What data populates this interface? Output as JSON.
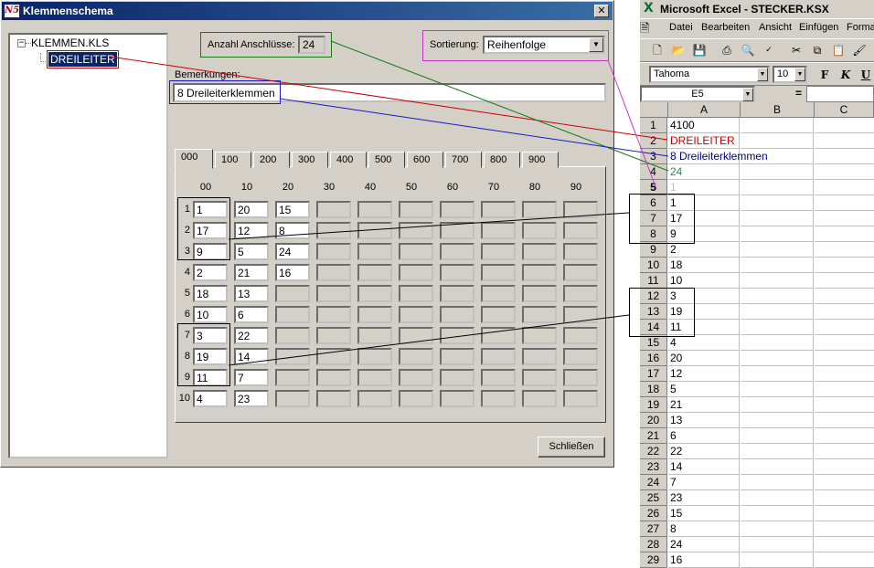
{
  "dialog": {
    "title": "Klemmenschema",
    "app_icon": "app-logo-icon",
    "close_icon": "close-icon",
    "tree": {
      "expander": "⊟",
      "root": "KLEMMEN.KLS",
      "child": "DREILEITER"
    },
    "anzahl_label": "Anzahl Anschlüsse:",
    "anzahl_value": "24",
    "sort_label": "Sortierung:",
    "sort_value": "Reihenfolge",
    "bemerkungen_label": "Bemerkungen:",
    "bemerkungen_value": "8 Dreileiterklemmen",
    "tabs": [
      "000",
      "100",
      "200",
      "300",
      "400",
      "500",
      "600",
      "700",
      "800",
      "900"
    ],
    "active_tab": "000",
    "columns": [
      "00",
      "10",
      "20",
      "30",
      "40",
      "50",
      "60",
      "70",
      "80",
      "90"
    ],
    "rows": [
      {
        "label": "1",
        "cells": [
          "1",
          "20",
          "15"
        ]
      },
      {
        "label": "2",
        "cells": [
          "17",
          "12",
          "8"
        ]
      },
      {
        "label": "3",
        "cells": [
          "9",
          "5",
          "24"
        ]
      },
      {
        "label": "4",
        "cells": [
          "2",
          "21",
          "16"
        ]
      },
      {
        "label": "5",
        "cells": [
          "18",
          "13"
        ]
      },
      {
        "label": "6",
        "cells": [
          "10",
          "6"
        ]
      },
      {
        "label": "7",
        "cells": [
          "3",
          "22"
        ]
      },
      {
        "label": "8",
        "cells": [
          "19",
          "14"
        ]
      },
      {
        "label": "9",
        "cells": [
          "11",
          "7"
        ]
      },
      {
        "label": "10",
        "cells": [
          "4",
          "23"
        ]
      }
    ],
    "close_button": "Schließen"
  },
  "excel": {
    "title": "Microsoft Excel - STECKER.KSX",
    "app_icon": "excel-logo-icon",
    "menu": [
      "Datei",
      "Bearbeiten",
      "Ansicht",
      "Einfügen",
      "Forma"
    ],
    "font_name": "Tahoma",
    "font_size": "10",
    "format_buttons": [
      "F",
      "K",
      "U"
    ],
    "name_box": "E5",
    "formula_sign": "=",
    "col_headers": [
      "A",
      "B",
      "C"
    ],
    "rows": [
      {
        "n": "1",
        "a": "4100",
        "color": "#000000"
      },
      {
        "n": "2",
        "a": "DREILEITER",
        "color": "#cc0000"
      },
      {
        "n": "3",
        "a": "8 Dreileiterklemmen",
        "color": "#000080"
      },
      {
        "n": "4",
        "a": "24",
        "color": "#2e8b57"
      },
      {
        "n": "5",
        "a": "1",
        "color": "#c0c0c0"
      },
      {
        "n": "6",
        "a": "1",
        "color": "#000000"
      },
      {
        "n": "7",
        "a": "17",
        "color": "#000000"
      },
      {
        "n": "8",
        "a": "9",
        "color": "#000000"
      },
      {
        "n": "9",
        "a": "2",
        "color": "#000000"
      },
      {
        "n": "10",
        "a": "18",
        "color": "#000000"
      },
      {
        "n": "11",
        "a": "10",
        "color": "#000000"
      },
      {
        "n": "12",
        "a": "3",
        "color": "#000000"
      },
      {
        "n": "13",
        "a": "19",
        "color": "#000000"
      },
      {
        "n": "14",
        "a": "11",
        "color": "#000000"
      },
      {
        "n": "15",
        "a": "4",
        "color": "#000000"
      },
      {
        "n": "16",
        "a": "20",
        "color": "#000000"
      },
      {
        "n": "17",
        "a": "12",
        "color": "#000000"
      },
      {
        "n": "18",
        "a": "5",
        "color": "#000000"
      },
      {
        "n": "19",
        "a": "21",
        "color": "#000000"
      },
      {
        "n": "20",
        "a": "13",
        "color": "#000000"
      },
      {
        "n": "21",
        "a": "6",
        "color": "#000000"
      },
      {
        "n": "22",
        "a": "22",
        "color": "#000000"
      },
      {
        "n": "23",
        "a": "14",
        "color": "#000000"
      },
      {
        "n": "24",
        "a": "7",
        "color": "#000000"
      },
      {
        "n": "25",
        "a": "23",
        "color": "#000000"
      },
      {
        "n": "26",
        "a": "15",
        "color": "#000000"
      },
      {
        "n": "27",
        "a": "8",
        "color": "#000000"
      },
      {
        "n": "28",
        "a": "24",
        "color": "#000000"
      },
      {
        "n": "29",
        "a": "16",
        "color": "#000000"
      }
    ]
  },
  "annotation_colors": {
    "red": "#cc0000",
    "green": "#1a7a1a",
    "blue": "#1a1acc",
    "magenta": "#cc33cc",
    "black": "#000000"
  }
}
